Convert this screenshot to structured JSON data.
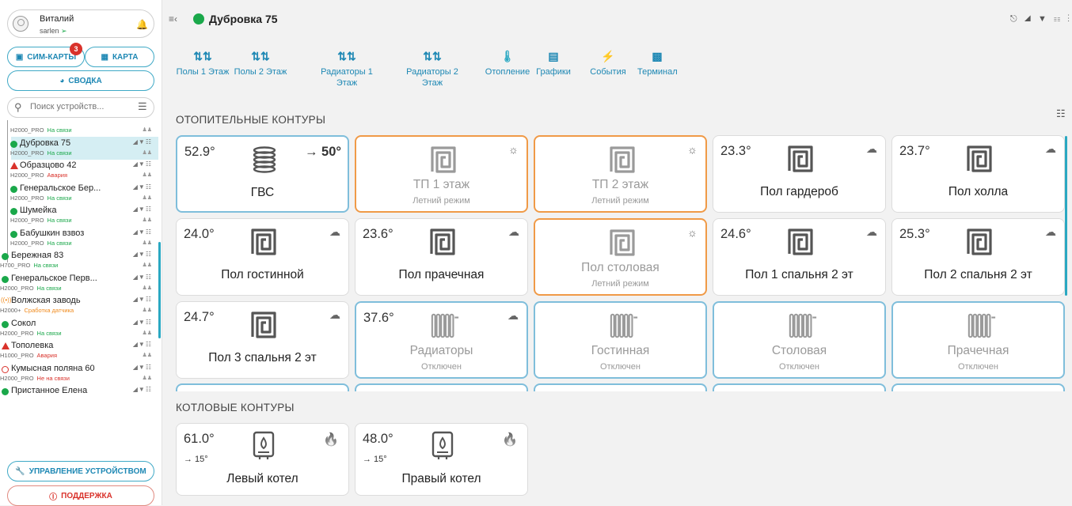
{
  "sidebar": {
    "user_name": "Виталий",
    "user_login": "sarlen",
    "sim_label": "СИМ-КАРТЫ",
    "sim_badge": "3",
    "map_label": "КАРТА",
    "summary_label": "СВОДКА",
    "search_placeholder": "Поиск устройств...",
    "devices": [
      {
        "title": "",
        "model": "H2000_PRO",
        "status": "На связи",
        "status_color": "#1aa84a",
        "dot": "none",
        "indent": true
      },
      {
        "title": "Дубровка 75",
        "model": "H2000_PRO",
        "status": "На связи",
        "status_color": "#1aa84a",
        "dot": "#1aa84a",
        "indent": true,
        "active": true
      },
      {
        "title": "Образцово 42",
        "model": "H2000_PRO",
        "status": "Авария",
        "status_color": "#d9322b",
        "dot": "alert",
        "indent": true
      },
      {
        "title": "Генеральское Бер...",
        "model": "H2000_PRO",
        "status": "На связи",
        "status_color": "#1aa84a",
        "dot": "#1aa84a",
        "indent": true
      },
      {
        "title": "Шумейка",
        "model": "H2000_PRO",
        "status": "На связи",
        "status_color": "#1aa84a",
        "dot": "#1aa84a",
        "indent": true
      },
      {
        "title": "Бабушкин взвоз",
        "model": "H2000_PRO",
        "status": "На связи",
        "status_color": "#1aa84a",
        "dot": "#1aa84a",
        "indent": true
      },
      {
        "title": "Бережная 83",
        "model": "H700_PRO",
        "status": "На связи",
        "status_color": "#1aa84a",
        "dot": "#1aa84a",
        "indent": false
      },
      {
        "title": "Генеральское Перв...",
        "model": "H2000_PRO",
        "status": "На связи",
        "status_color": "#1aa84a",
        "dot": "#1aa84a",
        "indent": false
      },
      {
        "title": "Волжская заводь",
        "model": "H2000+",
        "status": "Сработка датчика",
        "status_color": "#f08a1c",
        "dot": "sensor",
        "indent": false
      },
      {
        "title": "Сокол",
        "model": "H2000_PRO",
        "status": "На связи",
        "status_color": "#1aa84a",
        "dot": "#1aa84a",
        "indent": false
      },
      {
        "title": "Тополевка",
        "model": "H1000_PRO",
        "status": "Авария",
        "status_color": "#d9322b",
        "dot": "alert",
        "indent": false
      },
      {
        "title": "Кумысная поляна 60",
        "model": "H2000_PRO",
        "status": "Не на связи",
        "status_color": "#d9322b",
        "dot": "ring",
        "indent": false
      },
      {
        "title": "Пристанное Елена",
        "model": "",
        "status": "",
        "status_color": "#1aa84a",
        "dot": "#1aa84a",
        "indent": false
      }
    ],
    "manage_label": "УПРАВЛЕНИЕ УСТРОЙСТВОМ",
    "support_label": "ПОДДЕРЖКА"
  },
  "header": {
    "object_title": "Дубровка 75"
  },
  "tabs": [
    {
      "label": "Полы 1 Этаж",
      "icon": "sliders-icon"
    },
    {
      "label": "Полы 2 Этаж",
      "icon": "sliders-icon"
    },
    {
      "label": "Радиаторы 1 Этаж",
      "icon": "sliders-icon"
    },
    {
      "label": "Радиаторы 2 Этаж",
      "icon": "sliders-icon"
    },
    {
      "label": "Отопление",
      "icon": "thermometer-icon"
    },
    {
      "label": "Графики",
      "icon": "chart-icon"
    },
    {
      "label": "События",
      "icon": "lightning-icon"
    },
    {
      "label": "Терминал",
      "icon": "terminal-icon"
    }
  ],
  "heating_section_title": "ОТОПИТЕЛЬНЫЕ КОНТУРЫ",
  "boiler_section_title": "КОТЛОВЫЕ КОНТУРЫ",
  "heating_cards": [
    {
      "name": "ГВС",
      "temp": "52.9°",
      "setpoint": "→ 50°",
      "icon": "boiler-coil-icon",
      "border": "blue",
      "weather": ""
    },
    {
      "name": "ТП 1 этаж",
      "status": "Летний режим",
      "icon": "floor-heating-icon",
      "border": "orange",
      "weather": "sun"
    },
    {
      "name": "ТП 2 этаж",
      "status": "Летний режим",
      "icon": "floor-heating-icon",
      "border": "orange",
      "weather": "sun"
    },
    {
      "name": "Пол гардероб",
      "temp": "23.3°",
      "icon": "floor-heating-icon",
      "border": "none",
      "weather": "cloud"
    },
    {
      "name": "Пол холла",
      "temp": "23.7°",
      "icon": "floor-heating-icon",
      "border": "none",
      "weather": "cloud"
    },
    {
      "name": "Пол гостинной",
      "temp": "24.0°",
      "icon": "floor-heating-icon",
      "border": "none",
      "weather": "cloud"
    },
    {
      "name": "Пол прачечная",
      "temp": "23.6°",
      "icon": "floor-heating-icon",
      "border": "none",
      "weather": "cloud"
    },
    {
      "name": "Пол столовая",
      "status": "Летний режим",
      "icon": "floor-heating-icon",
      "border": "orange",
      "weather": "sun"
    },
    {
      "name": "Пол 1 спальня 2 эт",
      "temp": "24.6°",
      "icon": "floor-heating-icon",
      "border": "none",
      "weather": "cloud"
    },
    {
      "name": "Пол 2 спальня 2 эт",
      "temp": "25.3°",
      "icon": "floor-heating-icon",
      "border": "none",
      "weather": "cloud"
    },
    {
      "name": "Пол 3 спальня 2 эт",
      "temp": "24.7°",
      "icon": "floor-heating-icon",
      "border": "none",
      "weather": "cloud"
    },
    {
      "name": "Радиаторы",
      "temp": "37.6°",
      "status": "Отключен",
      "icon": "radiator-icon",
      "border": "blue",
      "weather": "cloud"
    },
    {
      "name": "Гостинная",
      "status": "Отключен",
      "icon": "radiator-icon",
      "border": "blue",
      "weather": ""
    },
    {
      "name": "Столовая",
      "status": "Отключен",
      "icon": "radiator-icon",
      "border": "blue",
      "weather": ""
    },
    {
      "name": "Прачечная",
      "status": "Отключен",
      "icon": "radiator-icon",
      "border": "blue",
      "weather": ""
    }
  ],
  "boiler_cards": [
    {
      "name": "Левый котел",
      "temp": "61.0°",
      "setpoint": "→ 15°",
      "icon": "boiler-icon"
    },
    {
      "name": "Правый котел",
      "temp": "48.0°",
      "setpoint": "→ 15°",
      "icon": "boiler-icon"
    }
  ],
  "colors": {
    "accent": "#1e88b4",
    "online": "#1aa84a",
    "alarm": "#d9322b",
    "summer": "#f09a47",
    "off": "#7fbedb"
  }
}
